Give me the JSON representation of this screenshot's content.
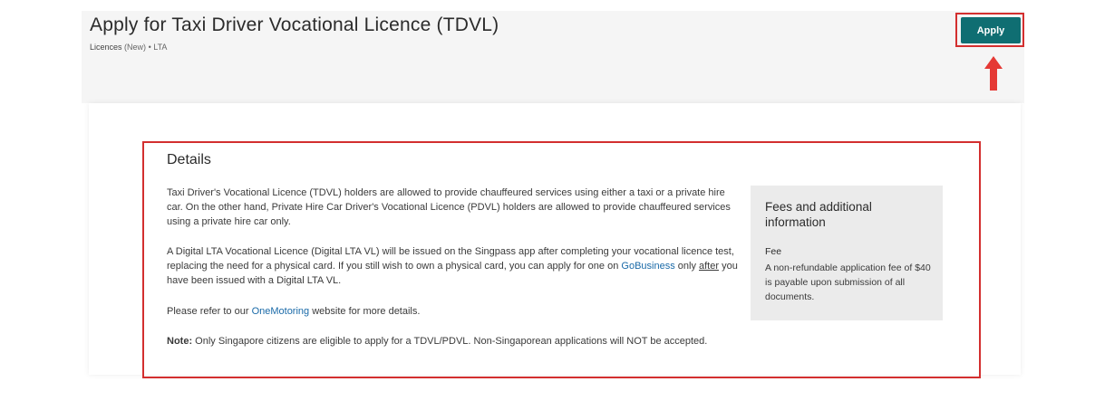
{
  "header": {
    "title": "Apply for Taxi Driver Vocational Licence (TDVL)",
    "breadcrumb": {
      "category": "Licences",
      "status": "(New)",
      "separator": "•",
      "agency": "LTA"
    },
    "apply_label": "Apply"
  },
  "details": {
    "heading": "Details",
    "para1": "Taxi Driver's Vocational Licence (TDVL) holders are allowed to provide chauffeured services using either a taxi or a private hire car. On the other hand, Private Hire Car Driver's Vocational Licence (PDVL) holders are allowed to provide chauffeured services using a private hire car only.",
    "para2": {
      "text_a": "A Digital LTA Vocational Licence (Digital LTA VL) will be issued on the Singpass app after completing your vocational licence test, replacing the need for a physical card. If you still wish to own a physical card, you can apply for one on ",
      "link": "GoBusiness",
      "text_b": " only ",
      "emphasis": "after",
      "text_c": " you have been issued with a Digital LTA VL."
    },
    "para3": {
      "text_a": "Please refer to our ",
      "link": "OneMotoring",
      "text_b": " website for more details."
    },
    "note": {
      "label": "Note:",
      "text": " Only Singapore citizens are eligible to apply for a TDVL/PDVL. Non-Singaporean applications will NOT be accepted."
    }
  },
  "fees": {
    "title": "Fees and additional information",
    "fee_label": "Fee",
    "fee_text": "A non-refundable application fee of $40 is payable upon submission of all documents."
  },
  "colors": {
    "accent": "#0f6e72",
    "highlight": "#d32f2f",
    "link": "#1a6aa8"
  }
}
